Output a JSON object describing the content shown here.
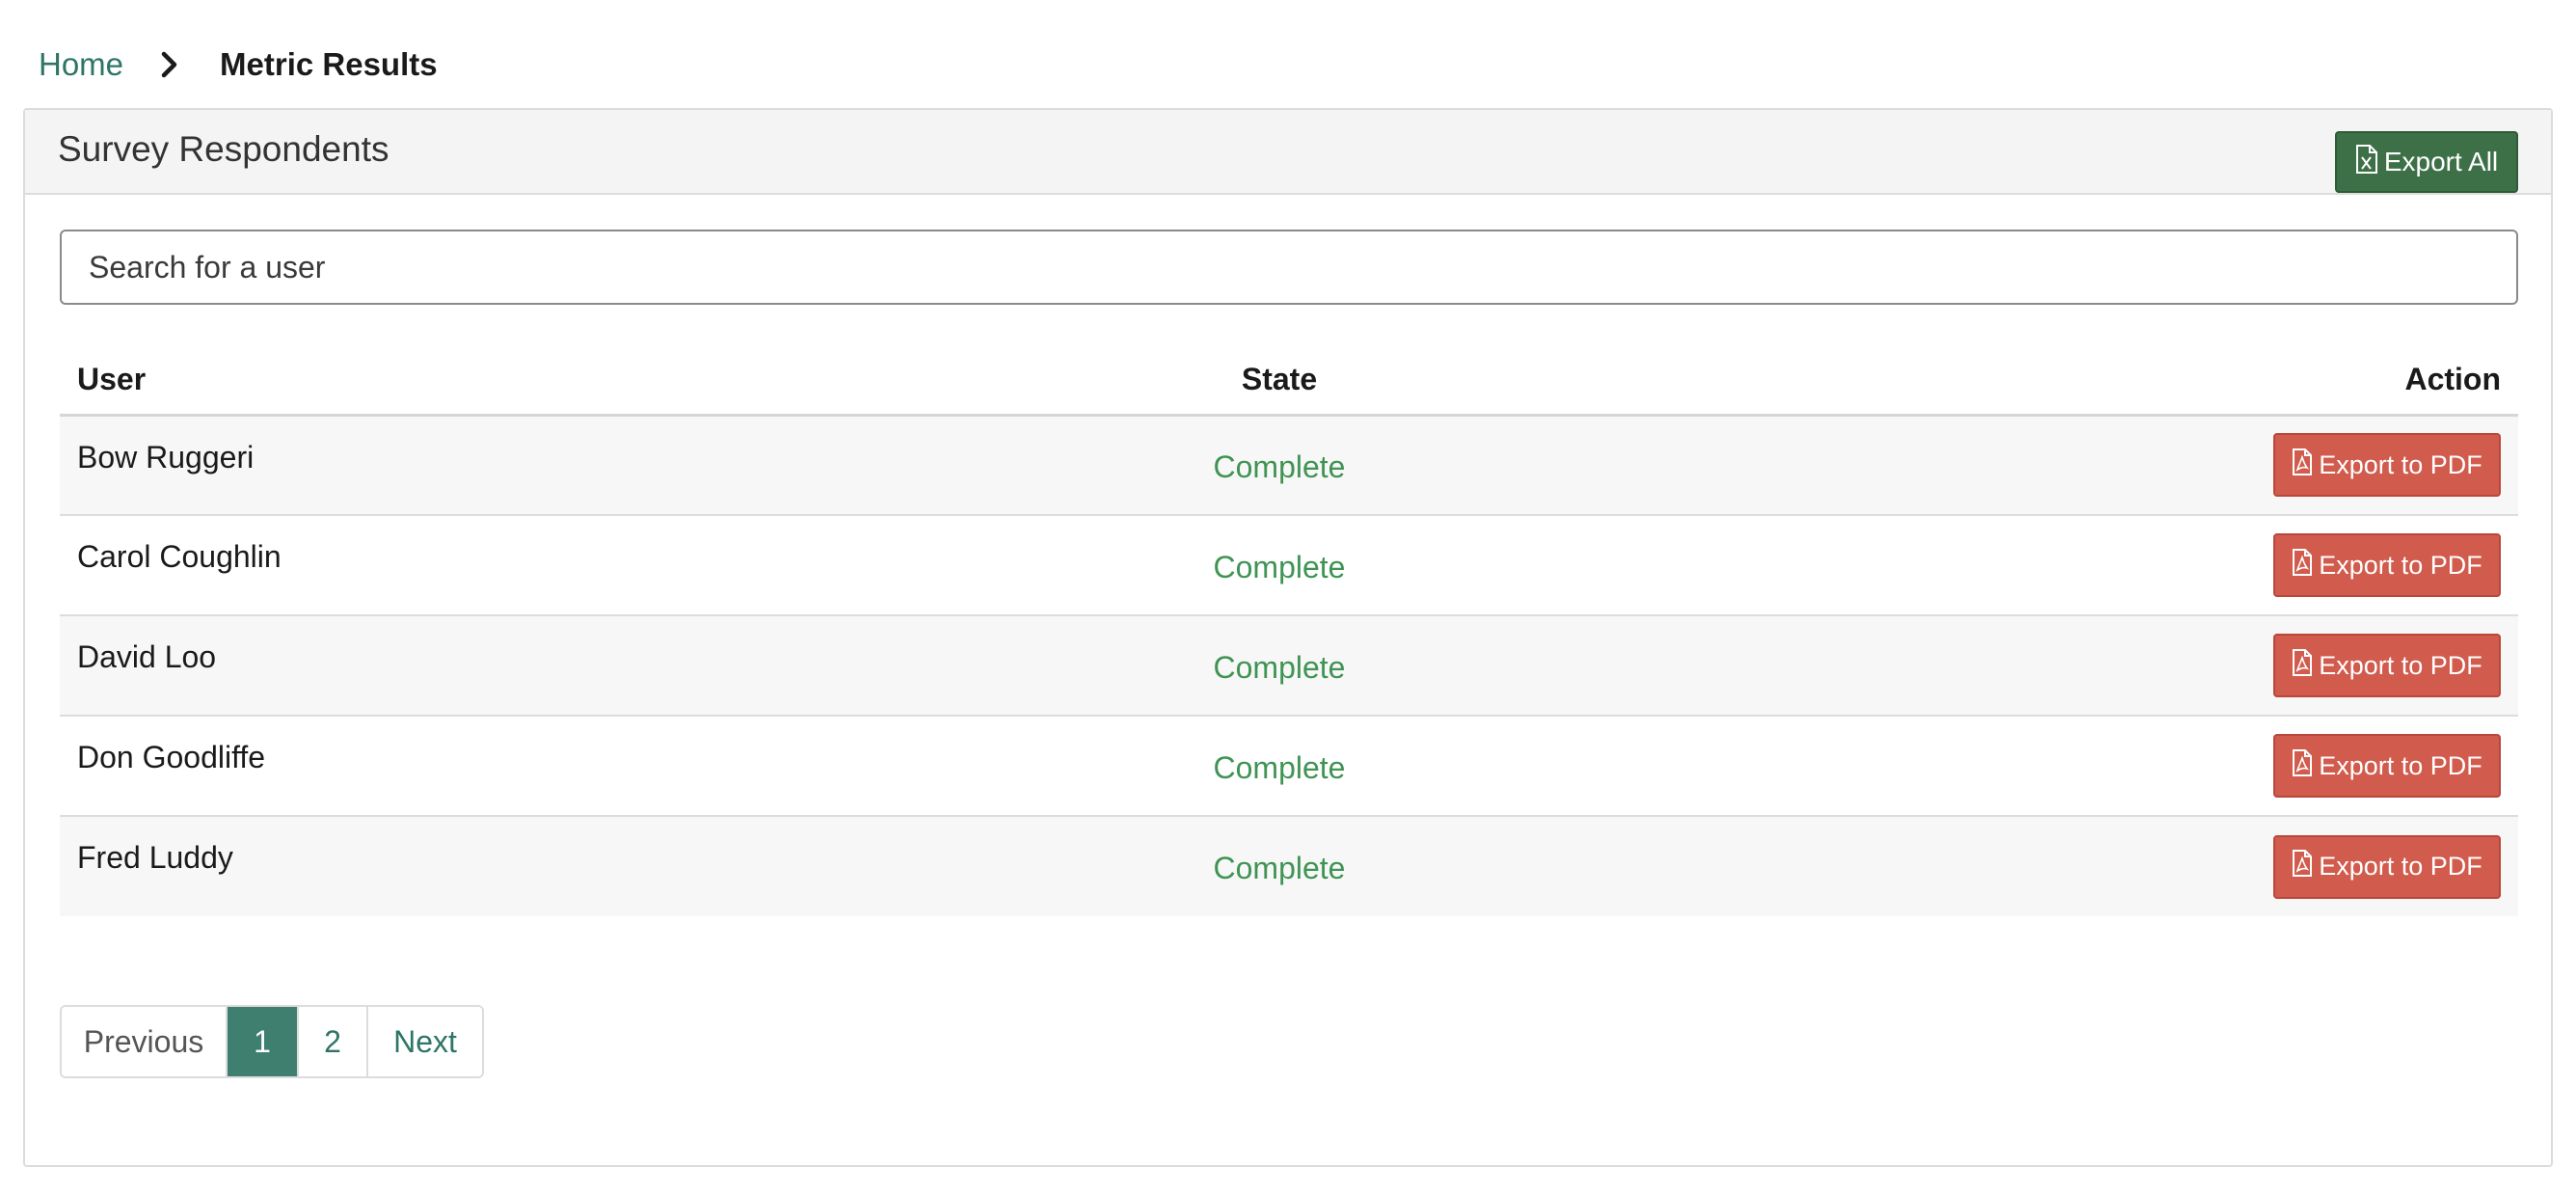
{
  "breadcrumb": {
    "home_label": "Home",
    "current_label": "Metric Results"
  },
  "panel": {
    "title": "Survey Respondents",
    "export_all_label": "Export All"
  },
  "search": {
    "placeholder": "Search for a user"
  },
  "table": {
    "headers": {
      "user": "User",
      "state": "State",
      "action": "Action"
    },
    "rows": [
      {
        "user": "Bow Ruggeri",
        "state": "Complete",
        "action_label": "Export to PDF"
      },
      {
        "user": "Carol Coughlin",
        "state": "Complete",
        "action_label": "Export to PDF"
      },
      {
        "user": "David Loo",
        "state": "Complete",
        "action_label": "Export to PDF"
      },
      {
        "user": "Don Goodliffe",
        "state": "Complete",
        "action_label": "Export to PDF"
      },
      {
        "user": "Fred Luddy",
        "state": "Complete",
        "action_label": "Export to PDF"
      }
    ]
  },
  "pagination": {
    "previous_label": "Previous",
    "pages": [
      "1",
      "2"
    ],
    "current_page": "1",
    "next_label": "Next"
  },
  "icons": {
    "breadcrumb_separator": "chevron-right-icon",
    "export_all": "file-excel-icon",
    "export_pdf": "file-pdf-icon"
  },
  "colors": {
    "link": "#2e7566",
    "export_all_button": "#3e7048",
    "pdf_button": "#d15b4d",
    "state_complete": "#3f9454",
    "active_page": "#3f7f70"
  }
}
